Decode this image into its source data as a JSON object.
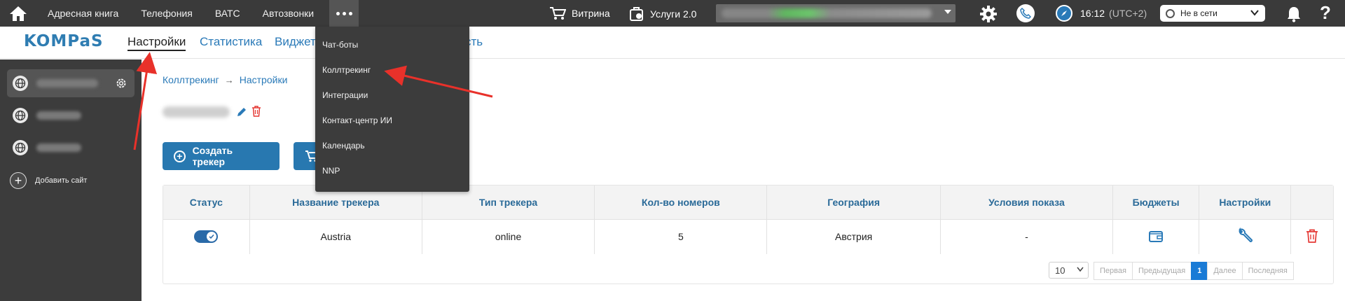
{
  "topbar": {
    "nav": [
      "Адресная книга",
      "Телефония",
      "ВАТС",
      "Автозвонки"
    ],
    "vitrina": "Витрина",
    "services": "Услуги 2.0",
    "time": "16:12",
    "timezone": "(UTC+2)",
    "status": "Не в сети"
  },
  "subnav": {
    "logo": "KOMPaS",
    "items": [
      "Настройки",
      "Статистика",
      "Виджет",
      "сть"
    ]
  },
  "sidebar": {
    "add_site": "Добавить сайт"
  },
  "breadcrumb": {
    "first": "Коллтрекинг",
    "second": "Настройки"
  },
  "buttons": {
    "create_tracker": "Создать трекер"
  },
  "table": {
    "headers": [
      "Статус",
      "Название трекера",
      "Тип трекера",
      "Кол-во номеров",
      "География",
      "Условия показа",
      "Бюджеты",
      "Настройки"
    ],
    "rows": [
      {
        "enabled": true,
        "name": "Austria",
        "type": "online",
        "numbers": "5",
        "geo": "Австрия",
        "conditions": "-"
      }
    ]
  },
  "pagination": {
    "page_size": "10",
    "first": "Первая",
    "prev": "Предыдущая",
    "current": "1",
    "next": "Далее",
    "last": "Последняя"
  },
  "dropdown": {
    "items": [
      "Чат-боты",
      "Коллтрекинг",
      "Интеграции",
      "Контакт-центр ИИ",
      "Календарь",
      "NNP"
    ]
  },
  "colors": {
    "topbar": "#3a3a3a",
    "accent": "#2878b0",
    "danger": "#e53935",
    "annotation_arrow": "#e8312a"
  }
}
